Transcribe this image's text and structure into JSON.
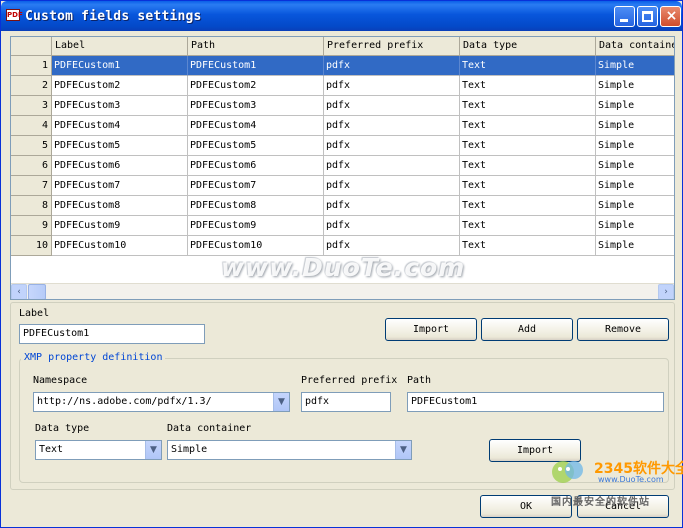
{
  "window": {
    "title": "Custom fields settings",
    "app_icon_text": "PDF",
    "titlebar_buttons": [
      "minimize",
      "maximize",
      "close"
    ],
    "close_glyph": "×"
  },
  "grid": {
    "columns": [
      "Label",
      "Path",
      "Preferred prefix",
      "Data type",
      "Data containe"
    ],
    "rows": [
      {
        "num": "1",
        "cells": [
          "PDFECustom1",
          "PDFECustom1",
          "pdfx",
          "Text",
          "Simple"
        ],
        "selected": true
      },
      {
        "num": "2",
        "cells": [
          "PDFECustom2",
          "PDFECustom2",
          "pdfx",
          "Text",
          "Simple"
        ]
      },
      {
        "num": "3",
        "cells": [
          "PDFECustom3",
          "PDFECustom3",
          "pdfx",
          "Text",
          "Simple"
        ]
      },
      {
        "num": "4",
        "cells": [
          "PDFECustom4",
          "PDFECustom4",
          "pdfx",
          "Text",
          "Simple"
        ]
      },
      {
        "num": "5",
        "cells": [
          "PDFECustom5",
          "PDFECustom5",
          "pdfx",
          "Text",
          "Simple"
        ]
      },
      {
        "num": "6",
        "cells": [
          "PDFECustom6",
          "PDFECustom6",
          "pdfx",
          "Text",
          "Simple"
        ]
      },
      {
        "num": "7",
        "cells": [
          "PDFECustom7",
          "PDFECustom7",
          "pdfx",
          "Text",
          "Simple"
        ]
      },
      {
        "num": "8",
        "cells": [
          "PDFECustom8",
          "PDFECustom8",
          "pdfx",
          "Text",
          "Simple"
        ]
      },
      {
        "num": "9",
        "cells": [
          "PDFECustom9",
          "PDFECustom9",
          "pdfx",
          "Text",
          "Simple"
        ]
      },
      {
        "num": "10",
        "cells": [
          "PDFECustom10",
          "PDFECustom10",
          "pdfx",
          "Text",
          "Simple"
        ]
      }
    ],
    "scroll_left_glyph": "‹",
    "scroll_right_glyph": "›",
    "selection_color": "#316ac5"
  },
  "form": {
    "label_caption": "Label",
    "label_value": "PDFECustom1",
    "import_button": "Import",
    "add_button": "Add",
    "remove_button": "Remove",
    "xmp_group_title": "XMP property definition",
    "namespace_caption": "Namespace",
    "namespace_value": "http://ns.adobe.com/pdfx/1.3/",
    "prefix_caption": "Preferred prefix",
    "prefix_value": "pdfx",
    "path_caption": "Path",
    "path_value": "PDFECustom1",
    "datatype_caption": "Data type",
    "datatype_value": "Text",
    "container_caption": "Data container",
    "container_value": "Simple",
    "import2_button": "Import",
    "dropdown_glyph": "▼"
  },
  "footer": {
    "ok_button": "OK",
    "cancel_button": "Cancel"
  },
  "overlays": {
    "watermark_text": "www.DuoTe.com",
    "badge_brand": "2345软件大全",
    "badge_url": "www.DuoTe.com",
    "badge_tagline": "国内最安全的软件站"
  },
  "colors": {
    "titlebar": "#0856dc",
    "dialog_bg": "#ece9d8",
    "group_title": "#0046d5"
  }
}
